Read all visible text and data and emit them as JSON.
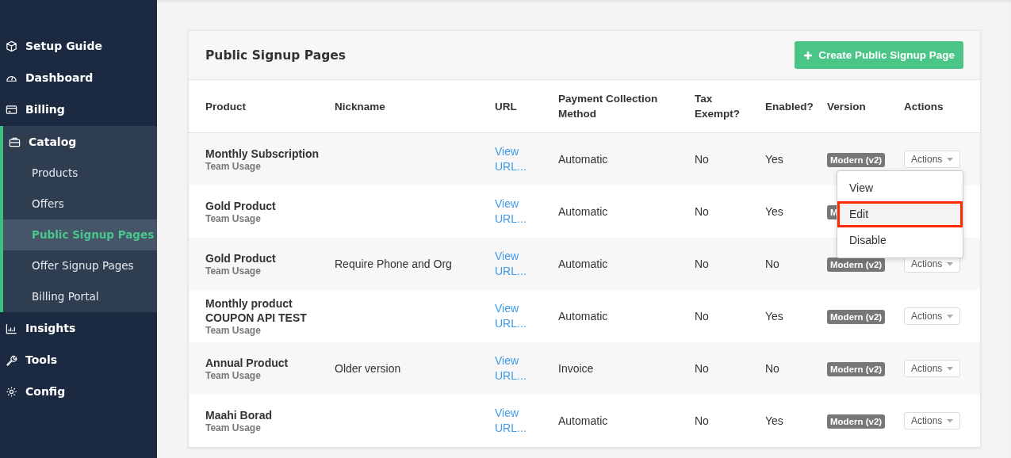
{
  "sidebar": {
    "items": [
      {
        "label": "Setup Guide",
        "expanded": false
      },
      {
        "label": "Dashboard",
        "expanded": false
      },
      {
        "label": "Billing",
        "expanded": false
      },
      {
        "label": "Catalog",
        "expanded": true,
        "children": [
          {
            "label": "Products",
            "selected": false
          },
          {
            "label": "Offers",
            "selected": false
          },
          {
            "label": "Public Signup Pages",
            "selected": true
          },
          {
            "label": "Offer Signup Pages",
            "selected": false
          },
          {
            "label": "Billing Portal",
            "selected": false
          }
        ]
      },
      {
        "label": "Insights",
        "expanded": false
      },
      {
        "label": "Tools",
        "expanded": false
      },
      {
        "label": "Config",
        "expanded": false
      }
    ]
  },
  "card": {
    "title": "Public Signup Pages",
    "create_button": "Create Public Signup Page"
  },
  "table": {
    "columns": [
      "Product",
      "Nickname",
      "URL",
      "Payment Collection Method",
      "Tax Exempt?",
      "Enabled?",
      "Version",
      "Actions"
    ],
    "rows": [
      {
        "product": "Monthly Subscription",
        "subtitle": "Team Usage",
        "url": "View URL...",
        "payment": "Automatic",
        "tax_exempt": "No",
        "enabled": "Yes",
        "version": "Modern (v2)",
        "actions": "Actions",
        "menu": [
          {
            "label": "View",
            "highlighted": false
          },
          {
            "label": "Edit",
            "highlighted": true
          },
          {
            "label": "Disable",
            "highlighted": false
          }
        ]
      },
      {
        "product": "Gold Product",
        "subtitle": "Team Usage",
        "url": "View URL...",
        "payment": "Automatic",
        "tax_exempt": "No",
        "enabled": "Yes",
        "version": "M"
      },
      {
        "product": "Gold Product",
        "subtitle": "Team Usage",
        "nickname": "Require Phone and Org",
        "url": "View URL...",
        "payment": "Automatic",
        "tax_exempt": "No",
        "enabled": "No",
        "version": "Modern (v2)",
        "actions": "Actions"
      },
      {
        "product": "Monthly product COUPON API TEST",
        "subtitle": "Team Usage",
        "url": "View URL...",
        "payment": "Automatic",
        "tax_exempt": "No",
        "enabled": "Yes",
        "version": "Modern (v2)",
        "actions": "Actions"
      },
      {
        "product": "Annual Product",
        "subtitle": "Team Usage",
        "nickname": "Older version",
        "url": "View URL...",
        "payment": "Invoice",
        "tax_exempt": "No",
        "enabled": "No",
        "version": "Modern (v2)",
        "actions": "Actions"
      },
      {
        "product": "Maahi Borad",
        "subtitle": "Team Usage",
        "url": "View URL...",
        "payment": "Automatic",
        "tax_exempt": "No",
        "enabled": "Yes",
        "version": "Modern (v2)",
        "actions": "Actions"
      }
    ]
  }
}
